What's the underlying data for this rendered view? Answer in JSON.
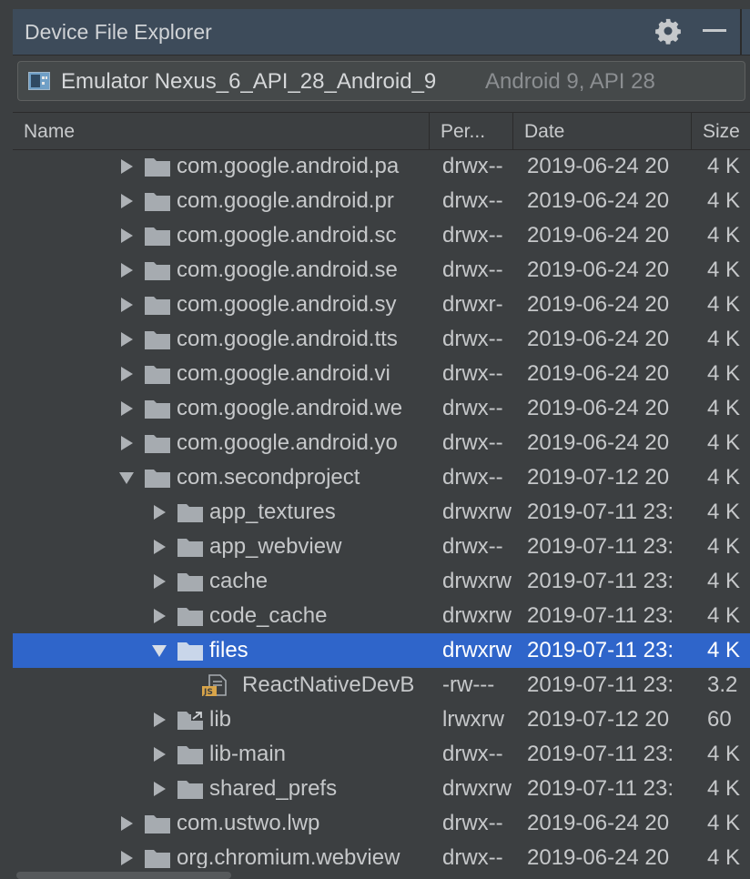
{
  "window": {
    "title": "Device File Explorer",
    "settings_icon": "gear-icon",
    "minimize_icon": "minimize-icon"
  },
  "device": {
    "name": "Emulator Nexus_6_API_28_Android_9",
    "description": "Android 9, API 28"
  },
  "columns": [
    "Name",
    "Per...",
    "Date",
    "Size"
  ],
  "rows": [
    {
      "name": "com.google.android.pa",
      "perm": "drwx--",
      "date": "2019-06-24 20",
      "size": "4 K",
      "depth": 0,
      "expand": "collapsed",
      "icon": "folder-icon",
      "selected": false
    },
    {
      "name": "com.google.android.pr",
      "perm": "drwx--",
      "date": "2019-06-24 20",
      "size": "4 K",
      "depth": 0,
      "expand": "collapsed",
      "icon": "folder-icon",
      "selected": false
    },
    {
      "name": "com.google.android.sc",
      "perm": "drwx--",
      "date": "2019-06-24 20",
      "size": "4 K",
      "depth": 0,
      "expand": "collapsed",
      "icon": "folder-icon",
      "selected": false
    },
    {
      "name": "com.google.android.se",
      "perm": "drwx--",
      "date": "2019-06-24 20",
      "size": "4 K",
      "depth": 0,
      "expand": "collapsed",
      "icon": "folder-icon",
      "selected": false
    },
    {
      "name": "com.google.android.sy",
      "perm": "drwxr-",
      "date": "2019-06-24 20",
      "size": "4 K",
      "depth": 0,
      "expand": "collapsed",
      "icon": "folder-icon",
      "selected": false
    },
    {
      "name": "com.google.android.tts",
      "perm": "drwx--",
      "date": "2019-06-24 20",
      "size": "4 K",
      "depth": 0,
      "expand": "collapsed",
      "icon": "folder-icon",
      "selected": false
    },
    {
      "name": "com.google.android.vi",
      "perm": "drwx--",
      "date": "2019-06-24 20",
      "size": "4 K",
      "depth": 0,
      "expand": "collapsed",
      "icon": "folder-icon",
      "selected": false
    },
    {
      "name": "com.google.android.we",
      "perm": "drwx--",
      "date": "2019-06-24 20",
      "size": "4 K",
      "depth": 0,
      "expand": "collapsed",
      "icon": "folder-icon",
      "selected": false
    },
    {
      "name": "com.google.android.yo",
      "perm": "drwx--",
      "date": "2019-06-24 20",
      "size": "4 K",
      "depth": 0,
      "expand": "collapsed",
      "icon": "folder-icon",
      "selected": false
    },
    {
      "name": "com.secondproject",
      "perm": "drwx--",
      "date": "2019-07-12 20",
      "size": "4 K",
      "depth": 0,
      "expand": "expanded",
      "icon": "folder-icon",
      "selected": false
    },
    {
      "name": "app_textures",
      "perm": "drwxrw",
      "date": "2019-07-11 23:",
      "size": "4 K",
      "depth": 1,
      "expand": "collapsed",
      "icon": "folder-icon",
      "selected": false
    },
    {
      "name": "app_webview",
      "perm": "drwx--",
      "date": "2019-07-11 23:",
      "size": "4 K",
      "depth": 1,
      "expand": "collapsed",
      "icon": "folder-icon",
      "selected": false
    },
    {
      "name": "cache",
      "perm": "drwxrw",
      "date": "2019-07-11 23:",
      "size": "4 K",
      "depth": 1,
      "expand": "collapsed",
      "icon": "folder-icon",
      "selected": false
    },
    {
      "name": "code_cache",
      "perm": "drwxrw",
      "date": "2019-07-11 23:",
      "size": "4 K",
      "depth": 1,
      "expand": "collapsed",
      "icon": "folder-icon",
      "selected": false
    },
    {
      "name": "files",
      "perm": "drwxrw",
      "date": "2019-07-11 23:",
      "size": "4 K",
      "depth": 1,
      "expand": "expanded",
      "icon": "folder-icon",
      "selected": true
    },
    {
      "name": "ReactNativeDevB",
      "perm": "-rw---",
      "date": "2019-07-11 23:",
      "size": "3.2",
      "depth": 2,
      "expand": "none",
      "icon": "js-file-icon",
      "selected": false
    },
    {
      "name": "lib",
      "perm": "lrwxrw",
      "date": "2019-07-12 20",
      "size": "60",
      "depth": 1,
      "expand": "collapsed",
      "icon": "symlink-folder-icon",
      "selected": false
    },
    {
      "name": "lib-main",
      "perm": "drwx--",
      "date": "2019-07-11 23:",
      "size": "4 K",
      "depth": 1,
      "expand": "collapsed",
      "icon": "folder-icon",
      "selected": false
    },
    {
      "name": "shared_prefs",
      "perm": "drwxrw",
      "date": "2019-07-11 23:",
      "size": "4 K",
      "depth": 1,
      "expand": "collapsed",
      "icon": "folder-icon",
      "selected": false
    },
    {
      "name": "com.ustwo.lwp",
      "perm": "drwx--",
      "date": "2019-06-24 20",
      "size": "4 K",
      "depth": 0,
      "expand": "collapsed",
      "icon": "folder-icon",
      "selected": false
    },
    {
      "name": "org.chromium.webview",
      "perm": "drwx--",
      "date": "2019-06-24 20",
      "size": "4 K",
      "depth": 0,
      "expand": "collapsed",
      "icon": "folder-icon",
      "selected": false
    }
  ],
  "colors": {
    "background": "#3c3f41",
    "title_bar": "#3d4b5a",
    "selection": "#2f65ca",
    "folder": "#a6abb0",
    "js_badge": "#d9a54a"
  }
}
